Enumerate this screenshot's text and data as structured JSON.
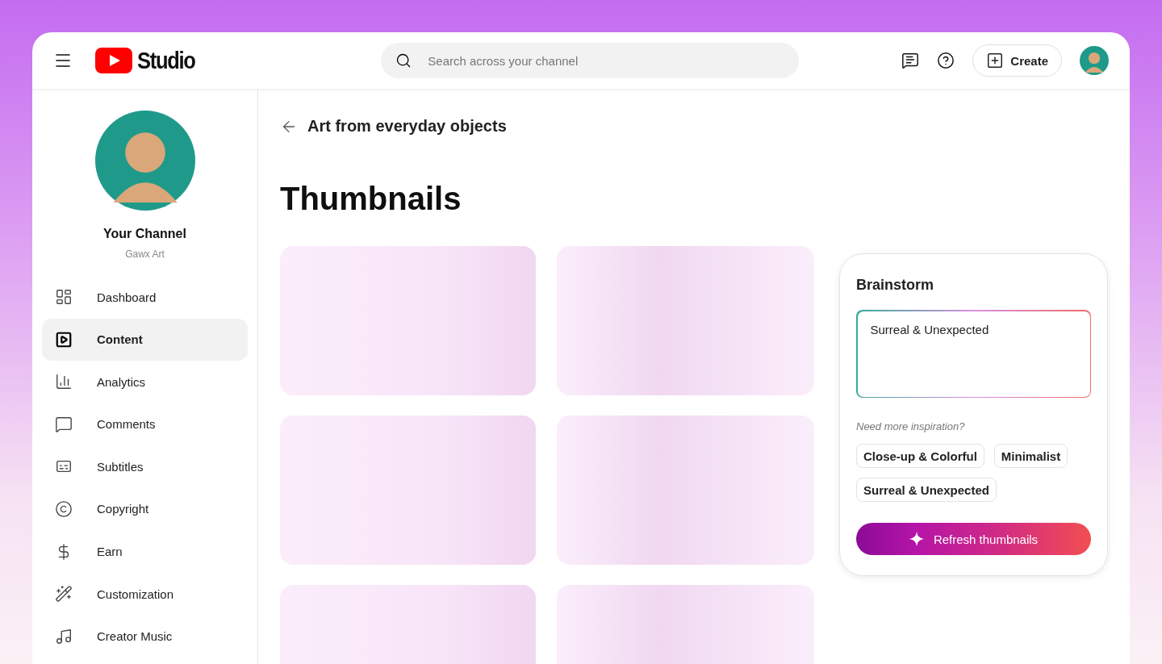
{
  "header": {
    "logo_text": "Studio",
    "search": {
      "placeholder": "Search across your channel"
    },
    "create_label": "Create"
  },
  "channel": {
    "name": "Your Channel",
    "handle": "Gawx Art"
  },
  "sidebar": {
    "items": [
      {
        "label": "Dashboard",
        "selected": false
      },
      {
        "label": "Content",
        "selected": true
      },
      {
        "label": "Analytics",
        "selected": false
      },
      {
        "label": "Comments",
        "selected": false
      },
      {
        "label": "Subtitles",
        "selected": false
      },
      {
        "label": "Copyright",
        "selected": false
      },
      {
        "label": "Earn",
        "selected": false
      },
      {
        "label": "Customization",
        "selected": false
      },
      {
        "label": "Creator Music",
        "selected": false
      }
    ]
  },
  "breadcrumb": {
    "title": "Art from everyday objects"
  },
  "page_title": "Thumbnails",
  "thumbnails": [
    {
      "kind": "loading"
    },
    {
      "kind": "loading"
    },
    {
      "kind": "loading"
    },
    {
      "kind": "loading"
    },
    {
      "kind": "loading"
    },
    {
      "kind": "loading"
    }
  ],
  "brainstorm": {
    "title": "Brainstorm",
    "prompt": {
      "value": "Surreal & Unexpected"
    },
    "hint": "Need more inspiration?",
    "suggestions": [
      {
        "label": "Close-up & Colorful"
      },
      {
        "label": "Minimalist"
      },
      {
        "label": "Surreal & Unexpected"
      }
    ],
    "action": "Refresh thumbnails"
  }
}
